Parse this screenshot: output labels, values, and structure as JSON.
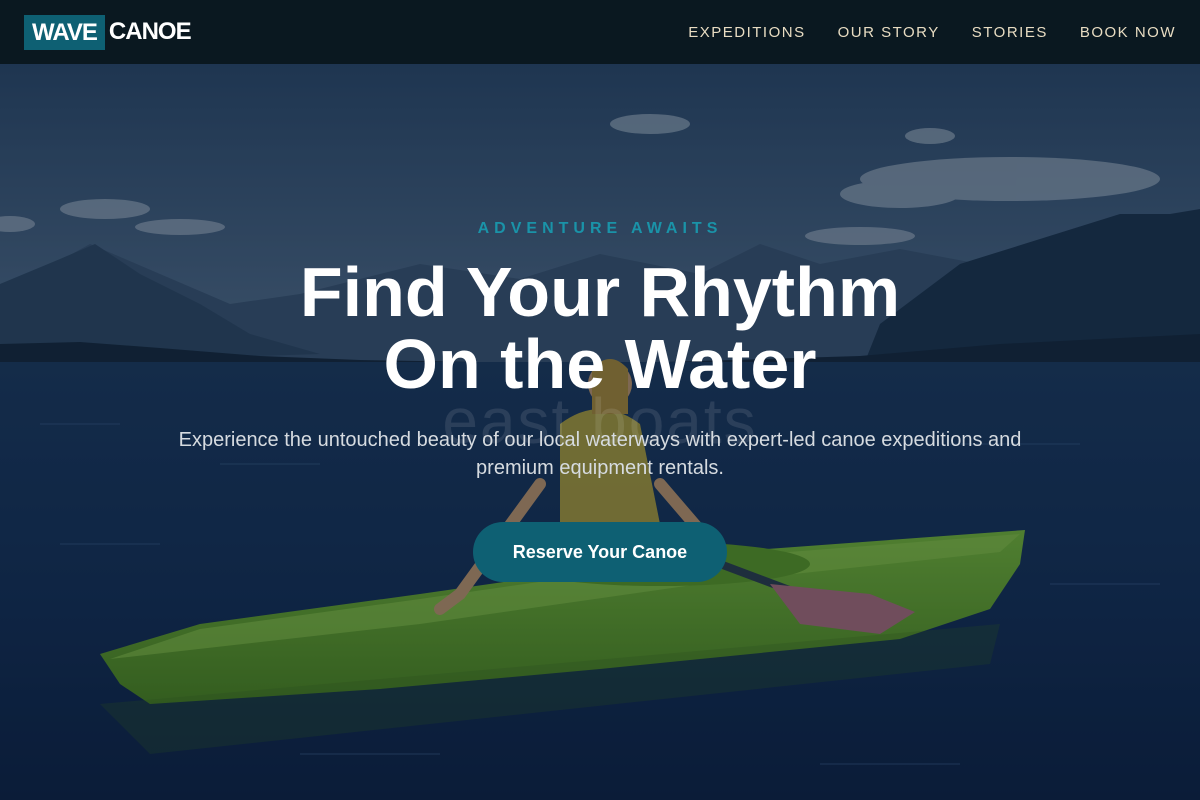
{
  "brand": {
    "part1": "WAVE",
    "part2": "CANOE"
  },
  "nav": {
    "items": [
      {
        "label": "EXPEDITIONS"
      },
      {
        "label": "OUR STORY"
      },
      {
        "label": "STORIES"
      },
      {
        "label": "BOOK NOW"
      }
    ]
  },
  "hero": {
    "eyebrow": "ADVENTURE AWAITS",
    "headline_line1": "Find Your Rhythm",
    "headline_line2": "On the Water",
    "subtext_line1": "Experience the untouched beauty of our local waterways with expert-led canoe expeditions and",
    "subtext_line2": "premium equipment rentals.",
    "cta_label": "Reserve Your Canoe",
    "watermark": "east boats"
  },
  "colors": {
    "accent": "#0e6073",
    "eyebrow": "#1a93a8",
    "header_bg": "#0a1820",
    "nav_text": "#e8dcc2"
  }
}
